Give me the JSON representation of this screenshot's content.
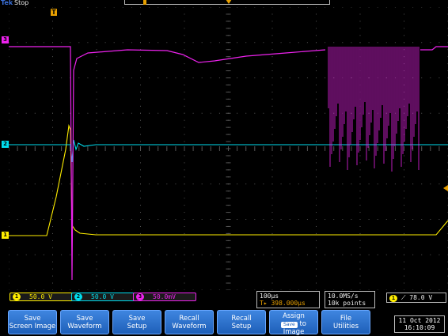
{
  "brand": "Tek",
  "run_state": "Stop",
  "trigger_marker_label": "T",
  "channel_markers": [
    "1",
    "2",
    "3"
  ],
  "channels": [
    {
      "id": "1",
      "scale": "50.0 V",
      "color": "#ffee00"
    },
    {
      "id": "2",
      "scale": "50.0 V",
      "color": "#00ddee"
    },
    {
      "id": "3",
      "scale": "50.0mV",
      "color": "#ee22ee"
    }
  ],
  "horizontal": {
    "time_per_div": "100µs",
    "trigger_delay": "398.000µs"
  },
  "acquisition": {
    "sample_rate": "10.0MS/s",
    "record_length": "10k points"
  },
  "trigger": {
    "source": "1",
    "slope": "rising",
    "level": "78.0 V"
  },
  "buttons": {
    "save_screen_image": "Save\nScreen Image",
    "save_waveform": "Save\nWaveform",
    "save_setup": "Save\nSetup",
    "recall_waveform": "Recall\nWaveform",
    "recall_setup": "Recall\nSetup",
    "assign_top": "Assign",
    "assign_save": "Save",
    "assign_to": "to",
    "assign_bottom": "Image",
    "file_utilities": "File\nUtilities"
  },
  "datetime": {
    "date": "11 Oct  2012",
    "time": "16:10:09"
  },
  "colors": {
    "ch1": "#ffee00",
    "ch2": "#00ddee",
    "ch3": "#ee22ee",
    "trigger": "#e8a000",
    "grid": "#555555"
  }
}
